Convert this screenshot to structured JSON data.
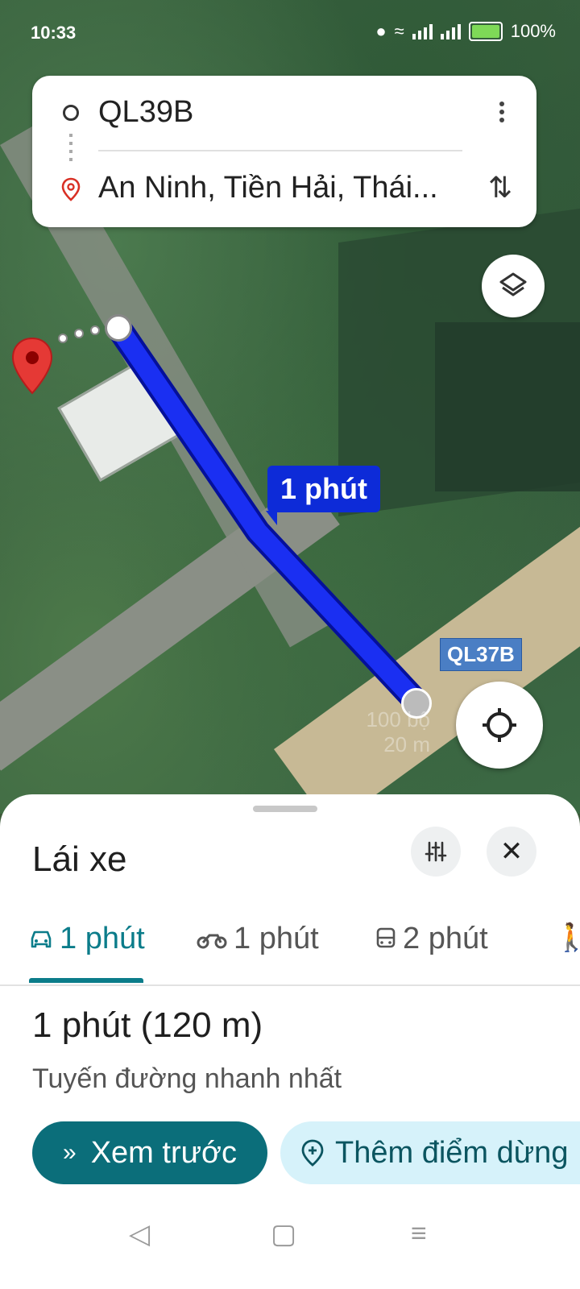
{
  "status_bar": {
    "time": "10:33",
    "battery": "100%"
  },
  "directions": {
    "origin": "QL39B",
    "destination": "An Ninh, Tiền Hải, Thái..."
  },
  "map": {
    "route_time_label": "1 phút",
    "road_label": "QL37B",
    "scale_top": "100 bộ",
    "scale_bottom": "20 m",
    "route_color": "#0d2bd8"
  },
  "sheet": {
    "title": "Lái xe",
    "modes": [
      {
        "icon": "car-icon",
        "label": "1 phút",
        "active": true
      },
      {
        "icon": "motorbike-icon",
        "label": "1 phút",
        "active": false
      },
      {
        "icon": "transit-icon",
        "label": "2 phút",
        "active": false
      }
    ],
    "summary_time": "1 phút",
    "summary_distance": "(120 m)",
    "subtitle": "Tuyến đường nhanh nhất",
    "preview_button": "Xem trước",
    "add_stop_button": "Thêm điểm dừng",
    "accent_color": "#0b7c8a"
  }
}
